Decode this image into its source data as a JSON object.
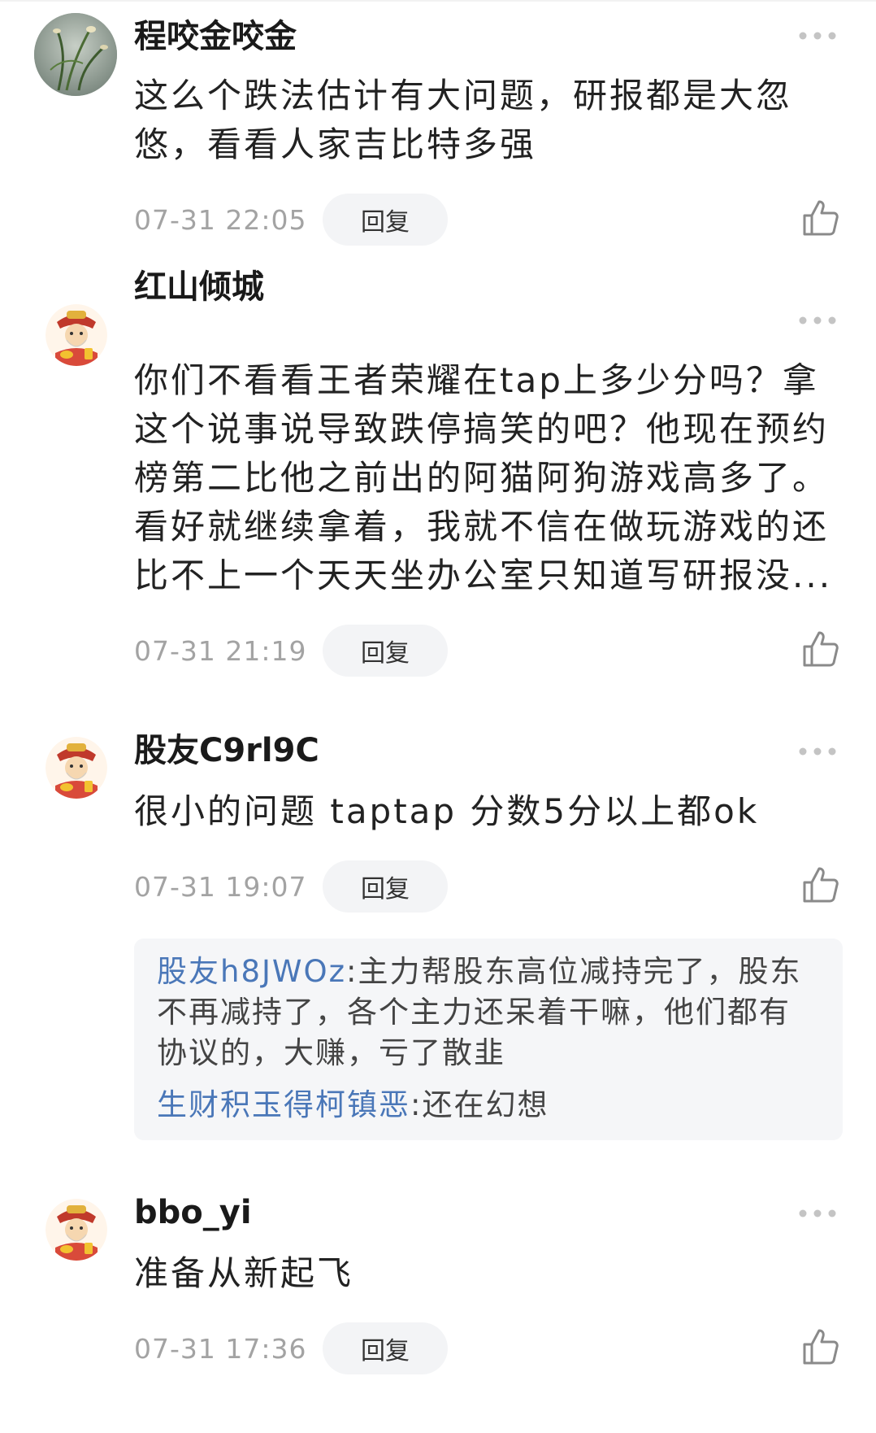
{
  "comments": [
    {
      "username": "程咬金咬金",
      "text": "这么个跌法估计有大问题，研报都是大忽悠，看看人家吉比特多强",
      "time": "07-31 22:05",
      "reply_label": "回复",
      "avatar": "plant-photo"
    },
    {
      "username": "红山倾城",
      "text": "你们不看看王者荣耀在tap上多少分吗？拿这个说事说导致跌停搞笑的吧？他现在预约榜第二比他之前出的阿猫阿狗游戏高多了。看好就继续拿着，我就不信在做玩游戏的还比不上一个天天坐办公室只知道写研报没...",
      "time": "07-31 21:19",
      "reply_label": "回复",
      "avatar": "god-of-wealth"
    },
    {
      "username": "股友C9rl9C",
      "text": "很小的问题 taptap 分数5分以上都ok",
      "time": "07-31 19:07",
      "reply_label": "回复",
      "avatar": "god-of-wealth",
      "replies": [
        {
          "user": "股友h8JWOz",
          "text": ":主力帮股东高位减持完了，股东不再减持了，各个主力还呆着干嘛，他们都有协议的，大赚，亏了散韭"
        },
        {
          "user": "生财积玉得柯镇恶",
          "text": ":还在幻想"
        }
      ]
    },
    {
      "username": "bbo_yi",
      "text": "准备从新起飞",
      "time": "07-31 17:36",
      "reply_label": "回复",
      "avatar": "god-of-wealth"
    }
  ],
  "icons": {
    "more": "more-dots-icon",
    "like": "thumbs-up-icon"
  },
  "colors": {
    "reply_username": "#4a77b8",
    "timestamp": "#a3a3a3",
    "reply_button_bg": "#f3f4f6",
    "replies_box_bg": "#f5f6f8"
  }
}
